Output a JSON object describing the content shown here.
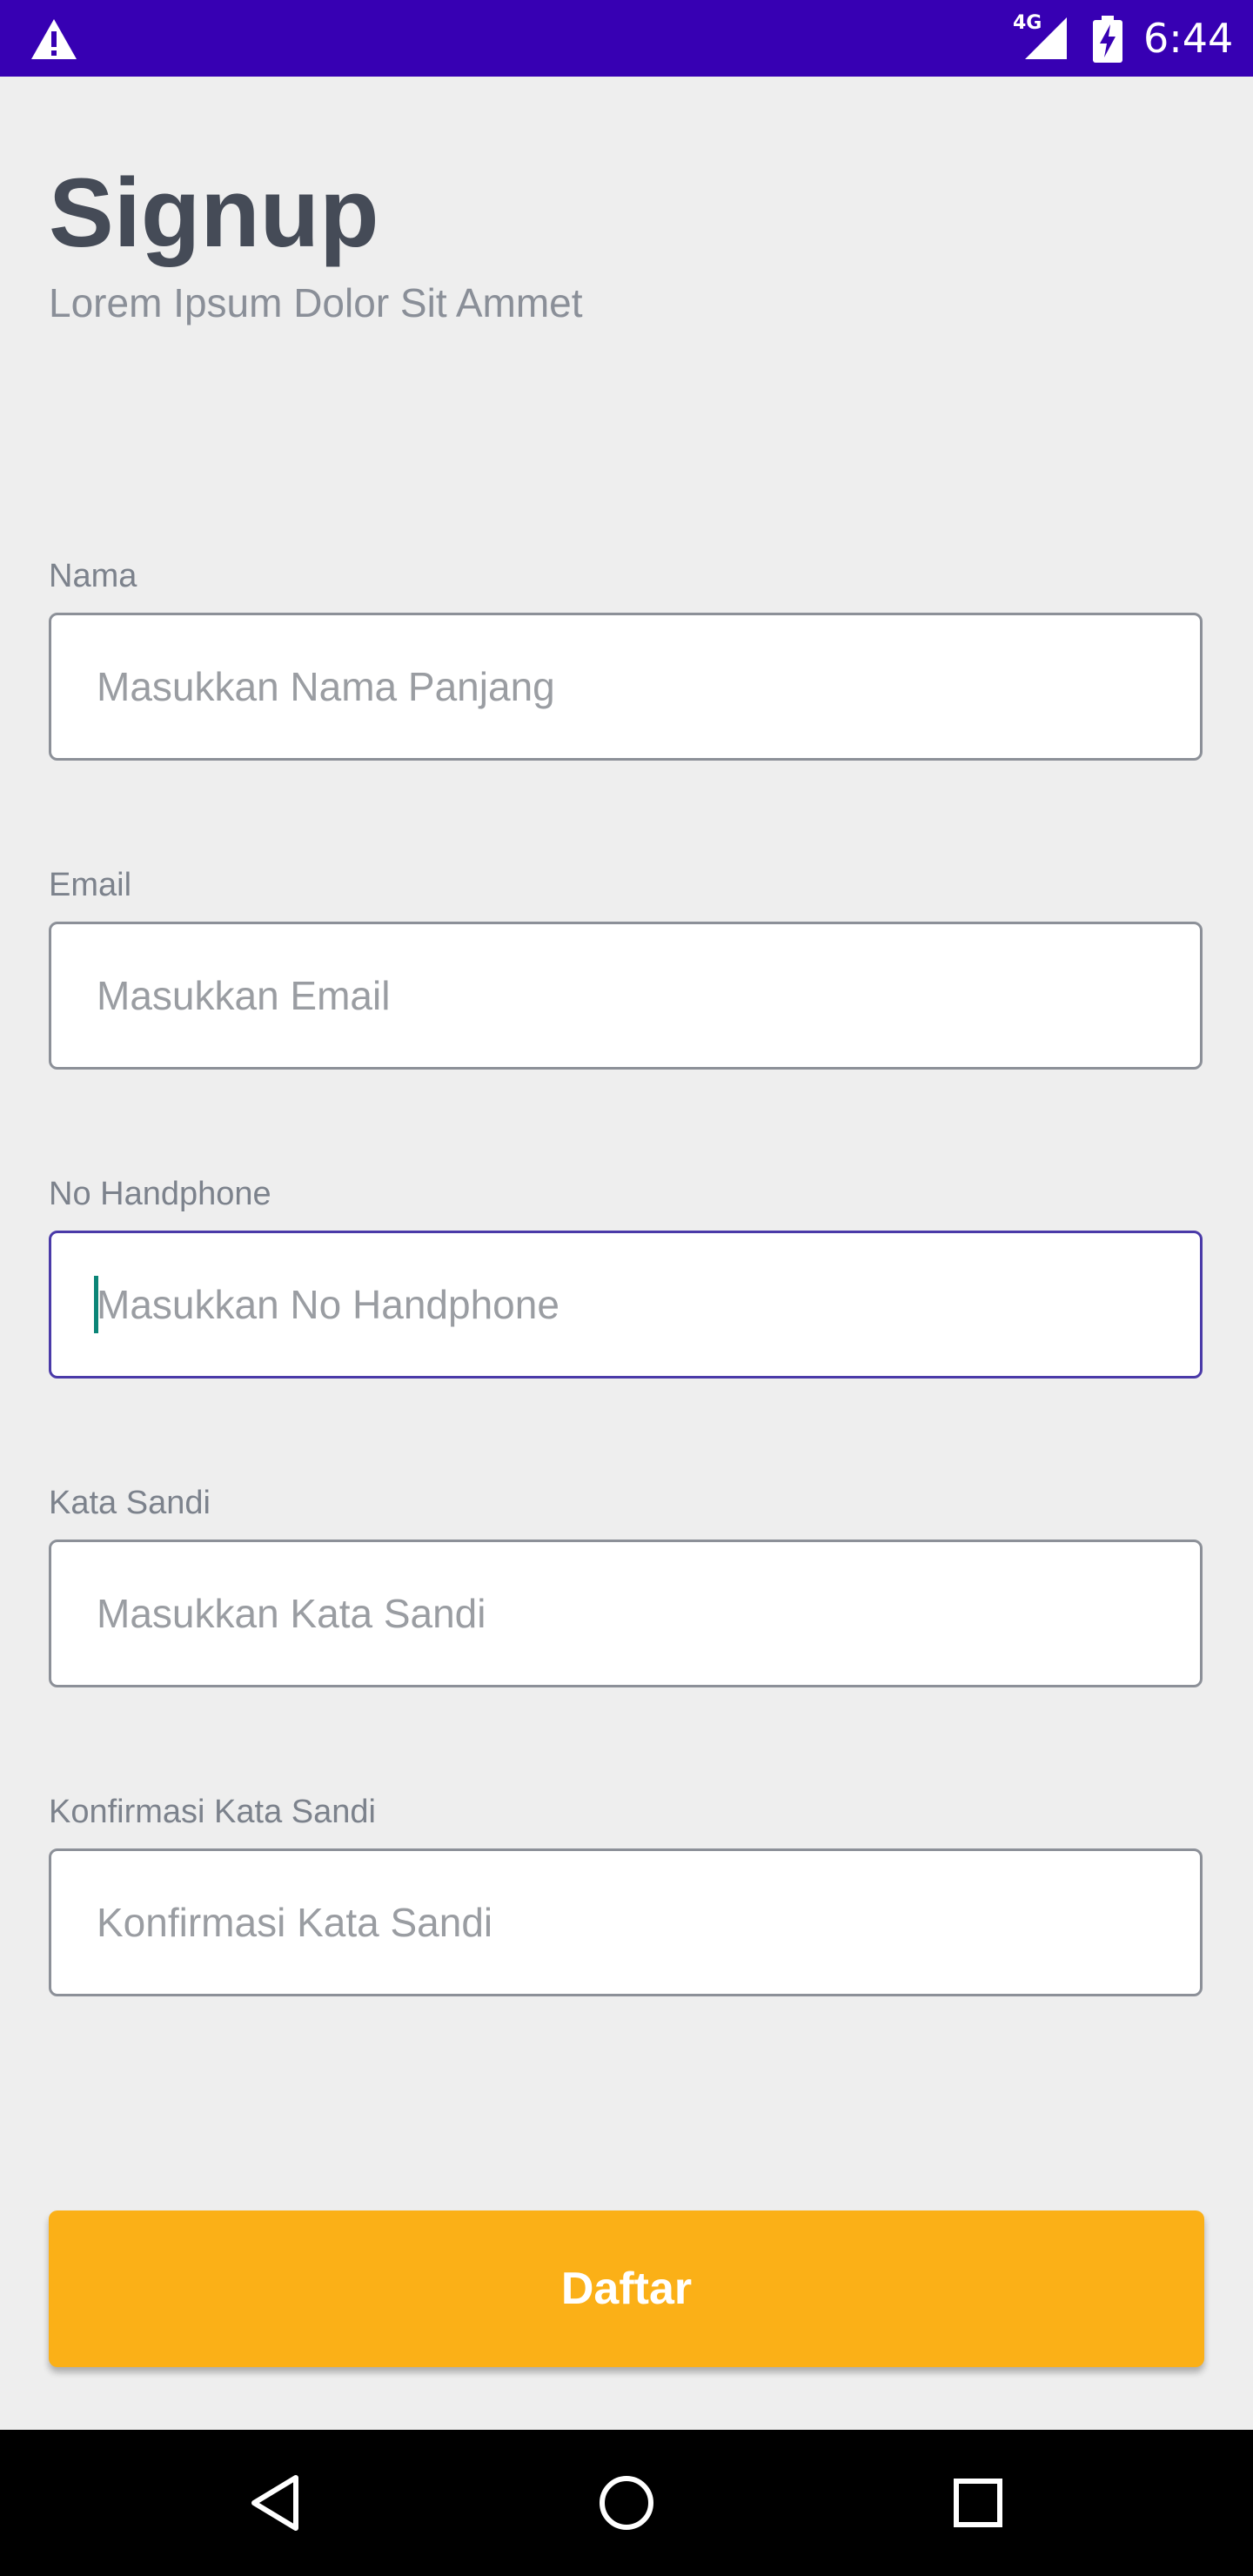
{
  "status_bar": {
    "network": "4G",
    "time": "6:44",
    "icons": [
      "warning-icon",
      "signal-icon",
      "battery-charging-icon"
    ],
    "background": "#3700b3"
  },
  "header": {
    "title": "Signup",
    "subtitle": "Lorem Ipsum Dolor Sit Ammet"
  },
  "form": {
    "name": {
      "label": "Nama",
      "placeholder": "Masukkan Nama Panjang",
      "value": ""
    },
    "email": {
      "label": "Email",
      "placeholder": "Masukkan Email",
      "value": ""
    },
    "phone": {
      "label": "No Handphone",
      "placeholder": "Masukkan No Handphone",
      "value": "",
      "focused": true
    },
    "password": {
      "label": "Kata Sandi",
      "placeholder": "Masukkan Kata Sandi",
      "value": ""
    },
    "confirm_password": {
      "label": "Konfirmasi Kata Sandi",
      "placeholder": "Konfirmasi Kata Sandi",
      "value": ""
    }
  },
  "submit": {
    "label": "Daftar",
    "color": "#fbb017"
  },
  "nav_bar": {
    "icons": [
      "back-icon",
      "home-icon",
      "recents-icon"
    ]
  }
}
